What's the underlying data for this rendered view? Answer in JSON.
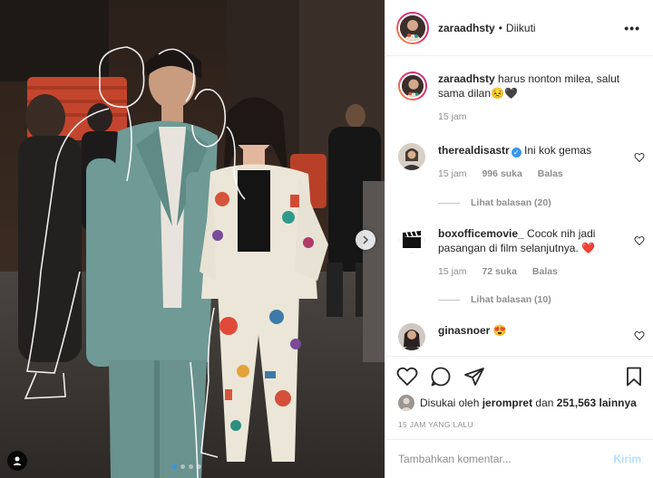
{
  "post": {
    "author": "zaraadhsty",
    "separator": "•",
    "follow_status": "Diikuti",
    "more": "•••",
    "caption_text": "harus nonton milea, salut sama dilan😣🖤",
    "caption_time": "15 jam"
  },
  "comments": [
    {
      "username": "therealdisastr",
      "verified": true,
      "text": "Ini kok gemas",
      "time": "15 jam",
      "likes": "996 suka",
      "reply": "Balas",
      "view_replies": "Lihat balasan (20)"
    },
    {
      "username": "boxofficemovie_",
      "verified": false,
      "text": "Cocok nih jadi pasangan di film selanjutnya. ❤️",
      "time": "15 jam",
      "likes": "72 suka",
      "reply": "Balas",
      "view_replies": "Lihat balasan (10)"
    },
    {
      "username": "ginasnoer",
      "verified": false,
      "text": "😍"
    }
  ],
  "likes": {
    "prefix": "Disukai oleh",
    "user": "jerompret",
    "joiner": "dan",
    "count": "251,563 lainnya"
  },
  "time_ago": "15 JAM YANG LALU",
  "add_comment": {
    "placeholder": "Tambahkan komentar...",
    "post_label": "Kirim"
  },
  "carousel": {
    "slide_count": 4,
    "active_index": 0
  },
  "colors": {
    "accent": "#3897f0",
    "heart_red": "#ed4956",
    "post_disabled": "#b2dffc"
  }
}
